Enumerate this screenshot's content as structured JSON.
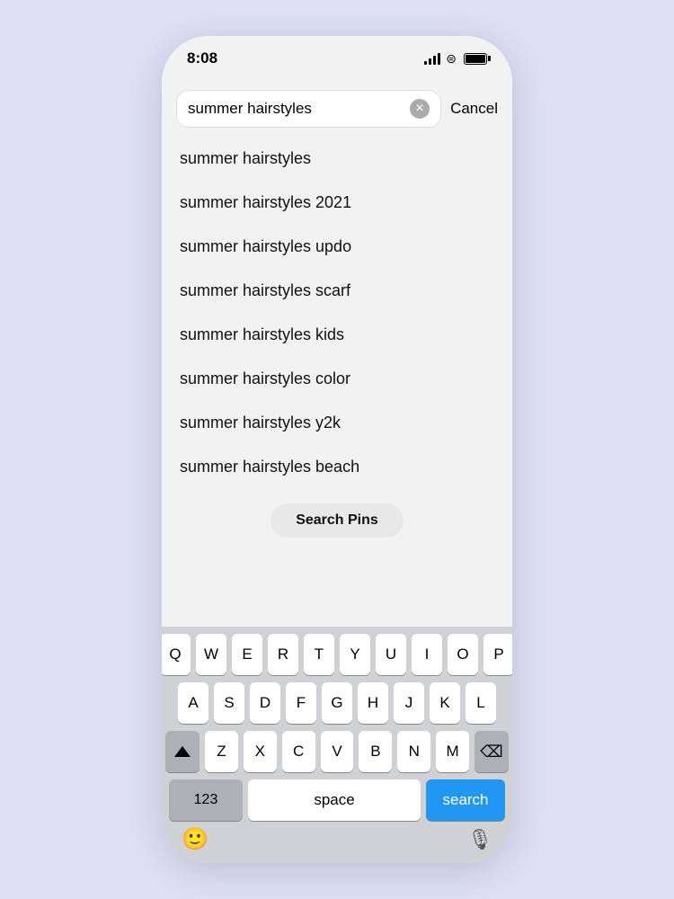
{
  "statusBar": {
    "time": "8:08"
  },
  "searchBar": {
    "inputValue": "summer hairstyles",
    "clearButton": "×",
    "cancelLabel": "Cancel"
  },
  "suggestions": [
    {
      "text": "summer hairstyles"
    },
    {
      "text": "summer hairstyles 2021"
    },
    {
      "text": "summer hairstyles updo"
    },
    {
      "text": "summer hairstyles scarf"
    },
    {
      "text": "summer hairstyles kids"
    },
    {
      "text": "summer hairstyles color"
    },
    {
      "text": "summer hairstyles y2k"
    },
    {
      "text": "summer hairstyles beach"
    }
  ],
  "searchPinsButton": "Search Pins",
  "keyboard": {
    "row1": [
      "Q",
      "W",
      "E",
      "R",
      "T",
      "Y",
      "U",
      "I",
      "O",
      "P"
    ],
    "row2": [
      "A",
      "S",
      "D",
      "F",
      "G",
      "H",
      "J",
      "K",
      "L"
    ],
    "row3": [
      "Z",
      "X",
      "C",
      "V",
      "B",
      "N",
      "M"
    ],
    "numberLabel": "123",
    "spaceLabel": "space",
    "searchLabel": "search"
  }
}
